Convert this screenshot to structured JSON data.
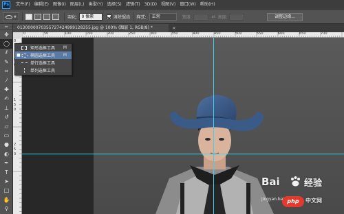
{
  "app": {
    "logo_text": "Ps"
  },
  "menu": {
    "items": [
      "文件(F)",
      "编辑(E)",
      "图像(I)",
      "图层(L)",
      "类型(Y)",
      "选择(S)",
      "滤镜(T)",
      "3D(D)",
      "视图(V)",
      "窗口(W)",
      "帮助(H)"
    ]
  },
  "options_bar": {
    "feather_label": "羽化:",
    "feather_value": "0 像素",
    "antialias_label": "消除锯齿",
    "antialias_checked": true,
    "style_label": "样式:",
    "style_value": "正常",
    "width_label": "宽度:",
    "height_label": "高度:",
    "refine_edge_label": "调整边缘..."
  },
  "document": {
    "tab_title": "0130000070355727424999128355.jpg @ 100% (图层 1, RGB/8) *",
    "close_glyph": "×"
  },
  "rulers": {
    "top_labels": [
      "0",
      "50",
      "100",
      "150",
      "200",
      "250",
      "300",
      "350",
      "400",
      "450",
      "500",
      "550",
      "600",
      "650",
      "700"
    ],
    "left_labels": [
      "0",
      "5",
      "0",
      "1",
      "5",
      "0",
      "2",
      "5",
      "0"
    ]
  },
  "tools": [
    {
      "icon": "move-icon",
      "glyph": "✥"
    },
    {
      "icon": "elliptical-marquee-icon",
      "glyph": "◯",
      "active": true
    },
    {
      "icon": "lasso-icon",
      "glyph": "ℓ"
    },
    {
      "icon": "quick-selection-icon",
      "glyph": "✎"
    },
    {
      "icon": "crop-icon",
      "glyph": "⌗"
    },
    {
      "icon": "eyedropper-icon",
      "glyph": "⁄"
    },
    {
      "icon": "healing-brush-icon",
      "glyph": "✚"
    },
    {
      "icon": "brush-icon",
      "glyph": "✍"
    },
    {
      "icon": "clone-stamp-icon",
      "glyph": "⊥"
    },
    {
      "icon": "history-brush-icon",
      "glyph": "↺"
    },
    {
      "icon": "eraser-icon",
      "glyph": "▱"
    },
    {
      "icon": "gradient-icon",
      "glyph": "▭"
    },
    {
      "icon": "blur-icon",
      "glyph": "●"
    },
    {
      "icon": "dodge-icon",
      "glyph": "◐"
    },
    {
      "icon": "pen-icon",
      "glyph": "✒"
    },
    {
      "icon": "type-icon",
      "glyph": "T"
    },
    {
      "icon": "path-selection-icon",
      "glyph": "➤"
    },
    {
      "icon": "rectangle-icon",
      "glyph": "□"
    },
    {
      "icon": "hand-icon",
      "glyph": "✋"
    },
    {
      "icon": "zoom-icon",
      "glyph": "⚲"
    }
  ],
  "flyout": {
    "items": [
      {
        "label": "矩形选框工具",
        "shortcut": "M",
        "icon": "rectangular-marquee-icon",
        "selected": false
      },
      {
        "label": "椭圆选框工具",
        "shortcut": "M",
        "icon": "elliptical-marquee-icon",
        "selected": true
      },
      {
        "label": "单行选框工具",
        "shortcut": "",
        "icon": "single-row-marquee-icon",
        "selected": false
      },
      {
        "label": "单列选框工具",
        "shortcut": "",
        "icon": "single-column-marquee-icon",
        "selected": false
      }
    ]
  },
  "watermark": {
    "baidu_logo": "Bai",
    "baidu_text": "经验",
    "url": "jingyan.baidu.com",
    "php_badge": "php",
    "cn_text": "中文网"
  },
  "colors": {
    "guide": "#3fd3e8",
    "hat": "#3a5a88",
    "flyout_highlight": "#5a7aa6"
  }
}
